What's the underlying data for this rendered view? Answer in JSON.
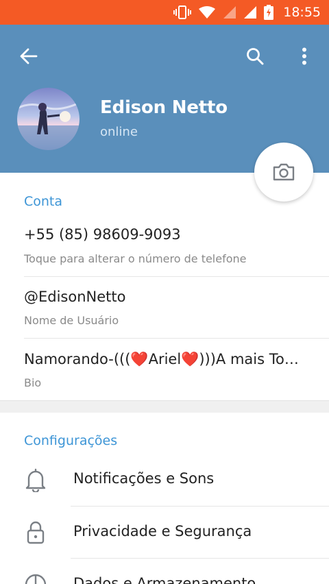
{
  "status_bar": {
    "time": "18:55",
    "icons": [
      "vibrate-icon",
      "wifi-icon",
      "signal-icon",
      "signal-icon",
      "battery-charging-icon"
    ],
    "background": "#f45a25"
  },
  "header": {
    "background": "#5a8fbb",
    "name": "Edison Netto",
    "status": "online",
    "icons": [
      "back-arrow-icon",
      "search-icon",
      "more-vertical-icon",
      "camera-icon"
    ]
  },
  "account": {
    "section_title": "Conta",
    "phone": "+55 (85) 98609-9093",
    "phone_hint": "Toque para alterar o número de telefone",
    "username": "@EdisonNetto",
    "username_hint": "Nome de Usuário",
    "bio_prefix": "Namorando-(((",
    "bio_heart1": "❤️",
    "bio_mid": "Ariel",
    "bio_heart2": "❤️",
    "bio_suffix": ")))A mais To…",
    "bio_hint": "Bio"
  },
  "settings": {
    "section_title": "Configurações",
    "items": [
      {
        "label": "Notificações e Sons",
        "icon": "bell-icon"
      },
      {
        "label": "Privacidade e Segurança",
        "icon": "lock-icon"
      },
      {
        "label": "Dados e Armazenamento",
        "icon": "data-usage-icon"
      }
    ]
  },
  "colors": {
    "accent": "#3d95d6",
    "header": "#5a8fbb",
    "statusbar": "#f45a25"
  }
}
